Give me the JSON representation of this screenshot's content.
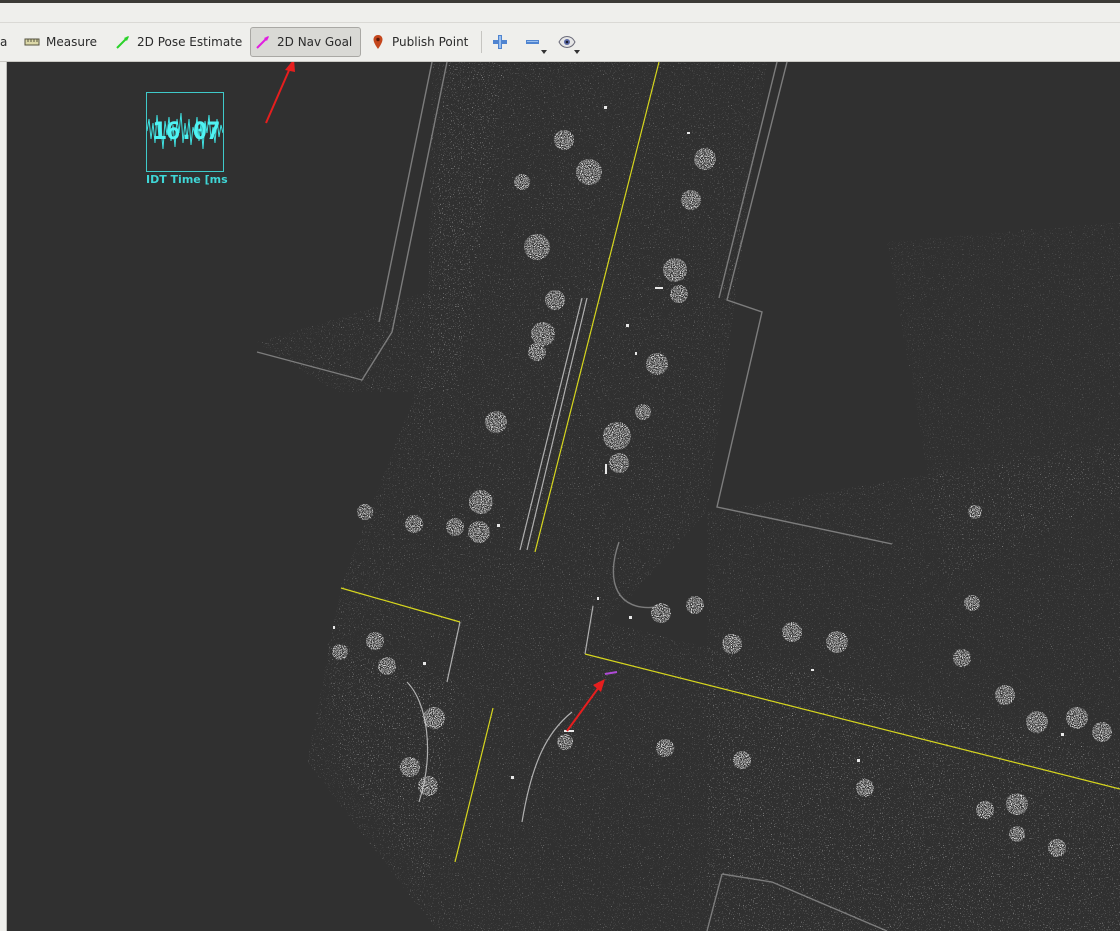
{
  "toolbar": {
    "items": [
      {
        "label": "a",
        "icon": "truncated-tool-icon"
      },
      {
        "label": "Measure",
        "icon": "ruler-icon"
      },
      {
        "label": "2D Pose Estimate",
        "icon": "pose-arrow-icon",
        "color": "#2ad22a"
      },
      {
        "label": "2D Nav Goal",
        "icon": "nav-goal-arrow-icon",
        "color": "#e01ee0",
        "active": true
      },
      {
        "label": "Publish Point",
        "icon": "map-pin-icon",
        "color": "#c4461c"
      }
    ],
    "icon_buttons": [
      {
        "name": "add-tool-button",
        "icon": "plus-icon"
      },
      {
        "name": "remove-tool-button",
        "icon": "minus-icon"
      },
      {
        "name": "view-options-button",
        "icon": "eye-icon"
      }
    ]
  },
  "viewport": {
    "overlay": {
      "value": "16.07",
      "label": "IDT Time [ms",
      "color": "#4ff3f3"
    },
    "background": "#303030",
    "road_line_color": "#d6d61e",
    "annotation_arrow_color": "#e61e1e"
  }
}
